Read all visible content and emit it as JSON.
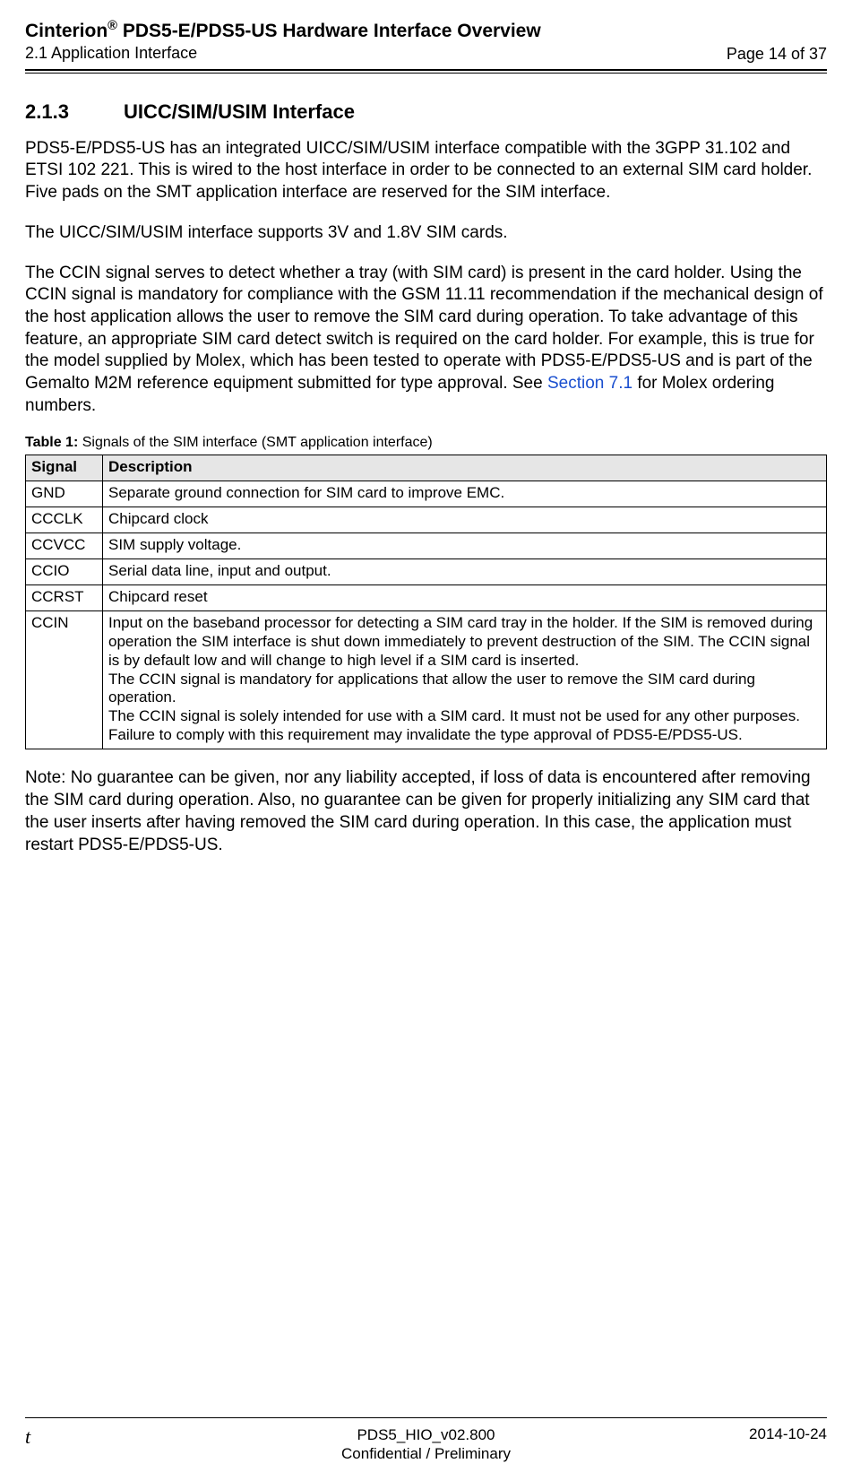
{
  "header": {
    "title_prefix": "Cinterion",
    "title_reg": "®",
    "title_suffix": " PDS5-E/PDS5-US Hardware Interface Overview",
    "subtitle": "2.1 Application Interface",
    "page_indicator": "Page 14 of 37"
  },
  "section": {
    "number": "2.1.3",
    "title": "UICC/SIM/USIM Interface"
  },
  "paragraphs": {
    "p1": "PDS5-E/PDS5-US has an integrated UICC/SIM/USIM interface compatible with the 3GPP 31.102 and ETSI 102 221. This is wired to the host interface in order to be connected to an external SIM card holder. Five pads on the SMT application interface are reserved for the SIM interface.",
    "p2": "The UICC/SIM/USIM interface supports 3V and 1.8V SIM cards.",
    "p3_a": "The CCIN signal serves to detect whether a tray (with SIM card) is present in the card holder. Using the CCIN signal is mandatory for compliance with the GSM 11.11 recommendation if the mechanical design of the host application allows the user to remove the SIM card during operation. To take advantage of this feature, an appropriate SIM card detect switch is required on the card holder. For example, this is true for the model supplied by Molex, which has been tested to operate with PDS5-E/PDS5-US and is part of the Gemalto M2M reference equipment submitted for type approval. See ",
    "p3_link": "Section 7.1",
    "p3_b": " for Molex ordering numbers.",
    "note": "Note: No guarantee can be given, nor any liability accepted, if loss of data is encountered after removing the SIM card during operation. Also, no guarantee can be given for properly initializing any SIM card that the user inserts after having removed the SIM card during operation. In this case, the application must restart PDS5-E/PDS5-US."
  },
  "table": {
    "caption_label": "Table 1:",
    "caption_text": "  Signals of the SIM interface (SMT application interface)",
    "headers": {
      "signal": "Signal",
      "description": "Description"
    },
    "rows": [
      {
        "signal": "GND",
        "description": "Separate ground connection for SIM card to improve EMC."
      },
      {
        "signal": "CCCLK",
        "description": "Chipcard clock"
      },
      {
        "signal": "CCVCC",
        "description": "SIM supply voltage."
      },
      {
        "signal": "CCIO",
        "description": "Serial data line, input and output."
      },
      {
        "signal": "CCRST",
        "description": "Chipcard reset"
      }
    ],
    "ccin": {
      "signal": "CCIN",
      "l1": "Input on the baseband processor for detecting a SIM card tray in the holder. If the SIM is removed during operation the SIM interface is shut down immediately to prevent destruction of the SIM. The CCIN signal is by default low and will change to high level if a SIM card is inserted.",
      "l2": "The CCIN signal is mandatory for applications that allow the user to remove the SIM card during operation.",
      "l3": "The CCIN signal is solely intended for use with a SIM card. It must not be used for any other purposes. Failure to comply with this requirement may invalidate the type approval of PDS5-E/PDS5-US."
    }
  },
  "footer": {
    "left": "t",
    "center_line1": "PDS5_HIO_v02.800",
    "center_line2": "Confidential / Preliminary",
    "right": "2014-10-24"
  }
}
